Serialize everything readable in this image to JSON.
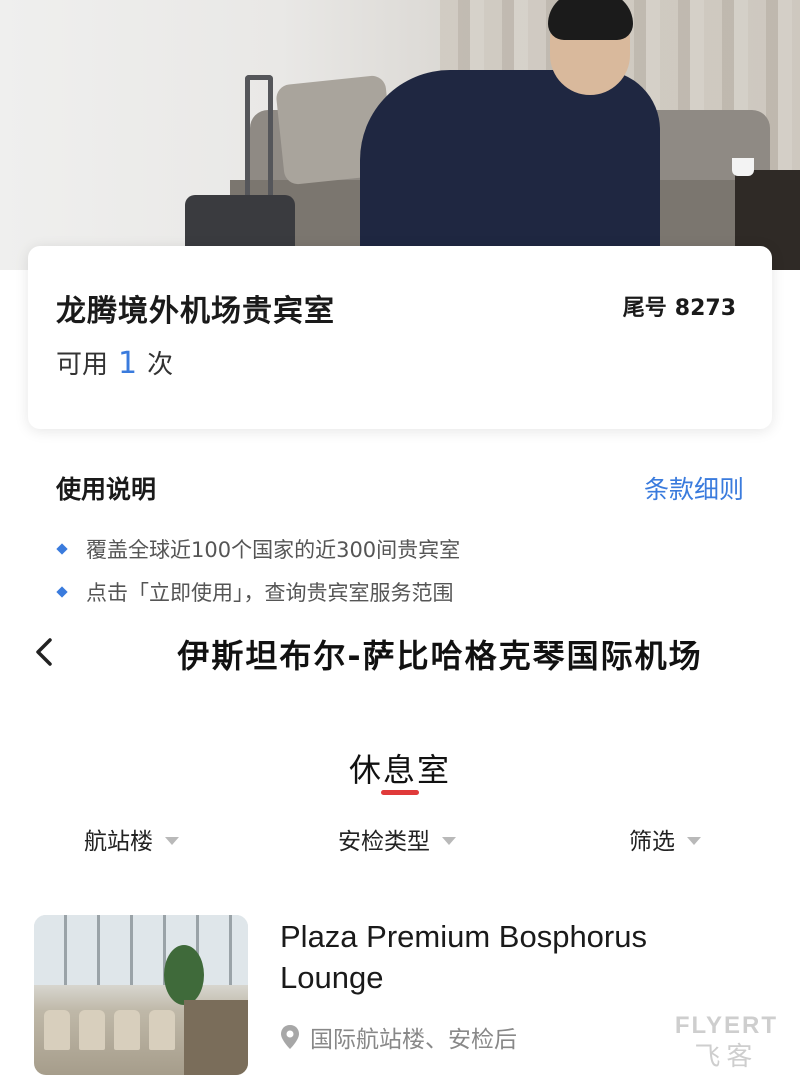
{
  "card": {
    "title": "龙腾境外机场贵宾室",
    "tail_label": "尾号",
    "tail_number": "8273",
    "usage_prefix": "可用",
    "usage_count": "1",
    "usage_suffix": "次"
  },
  "instructions": {
    "title": "使用说明",
    "terms_link": "条款细则",
    "bullets": [
      "覆盖全球近100个国家的近300间贵宾室",
      "点击「立即使用」，查询贵宾室服务范围"
    ]
  },
  "header": {
    "title": "伊斯坦布尔-萨比哈格克琴国际机场"
  },
  "tab": {
    "label": "休息室",
    "active_color": "#e03a3a"
  },
  "filters": [
    {
      "label": "航站楼"
    },
    {
      "label": "安检类型"
    },
    {
      "label": "筛选"
    }
  ],
  "lounges": [
    {
      "name": "Plaza Premium Bosphorus Lounge",
      "location": "国际航站楼、安检后"
    }
  ],
  "watermark": {
    "line1": "FLYERT",
    "line2": "飞客"
  },
  "colors": {
    "accent": "#3a7bdd",
    "tab_indicator": "#e03a3a"
  }
}
